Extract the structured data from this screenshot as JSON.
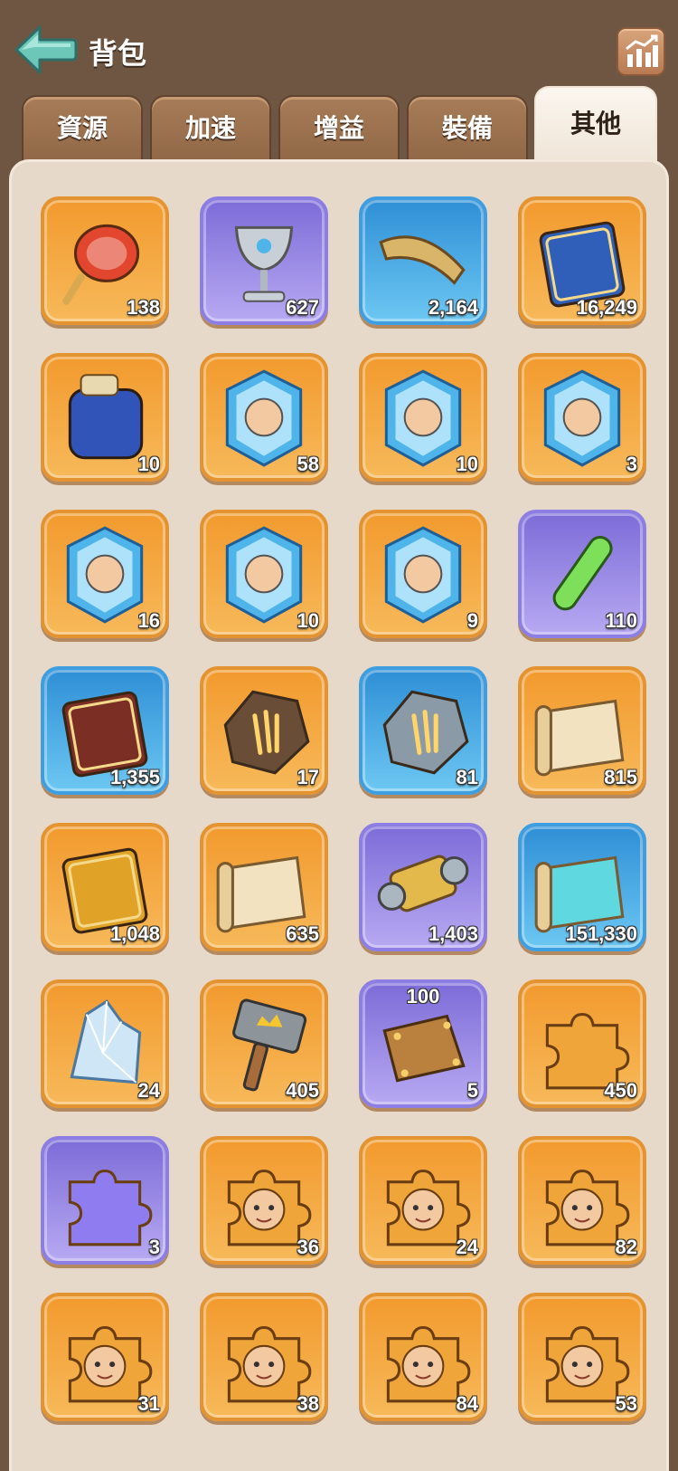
{
  "header": {
    "title": "背包"
  },
  "tabs": [
    {
      "label": "資源",
      "active": false
    },
    {
      "label": "加速",
      "active": false
    },
    {
      "label": "增益",
      "active": false
    },
    {
      "label": "裝備",
      "active": false
    },
    {
      "label": "其他",
      "active": true
    }
  ],
  "items": [
    {
      "name": "potion-flask-icon",
      "color": "orange",
      "count": "138"
    },
    {
      "name": "silver-goblet-icon",
      "color": "purple",
      "count": "627"
    },
    {
      "name": "war-horn-icon",
      "color": "blue",
      "count": "2,164"
    },
    {
      "name": "academy-book-icon",
      "color": "orange",
      "count": "16,249"
    },
    {
      "name": "blue-backpack-icon",
      "color": "orange",
      "count": "10"
    },
    {
      "name": "academy-crystal-icon",
      "color": "orange",
      "count": "58"
    },
    {
      "name": "hero-crystal-warrior-icon",
      "color": "orange",
      "count": "10"
    },
    {
      "name": "hero-crystal-monocle-icon",
      "color": "orange",
      "count": "3"
    },
    {
      "name": "hero-crystal-silver-hair-icon",
      "color": "orange",
      "count": "16"
    },
    {
      "name": "hero-crystal-crowned-icon",
      "color": "orange",
      "count": "10"
    },
    {
      "name": "hero-crystal-knight-icon",
      "color": "orange",
      "count": "9"
    },
    {
      "name": "green-vial-icon",
      "color": "purple",
      "count": "110"
    },
    {
      "name": "paw-book-icon",
      "color": "blue",
      "count": "1,355"
    },
    {
      "name": "gold-claw-stone-icon",
      "color": "orange",
      "count": "17"
    },
    {
      "name": "silver-claw-stone-icon",
      "color": "blue",
      "count": "81"
    },
    {
      "name": "gem-scroll-icon",
      "color": "orange",
      "count": "815"
    },
    {
      "name": "gem-book-icon",
      "color": "orange",
      "count": "1,048"
    },
    {
      "name": "map-scroll-icon",
      "color": "orange",
      "count": "635"
    },
    {
      "name": "gold-thread-spool-icon",
      "color": "purple",
      "count": "1,403"
    },
    {
      "name": "blue-cloth-icon",
      "color": "blue",
      "count": "151,330"
    },
    {
      "name": "ice-crystal-icon",
      "color": "orange",
      "count": "24"
    },
    {
      "name": "crown-hammer-icon",
      "color": "orange",
      "count": "405"
    },
    {
      "name": "bronze-plate-icon",
      "color": "purple",
      "count": "5",
      "top_label": "100"
    },
    {
      "name": "orange-puzzle-piece-icon",
      "color": "orange",
      "count": "450"
    },
    {
      "name": "purple-puzzle-piece-icon",
      "color": "purple",
      "count": "3"
    },
    {
      "name": "pirate-hero-puzzle-icon",
      "color": "orange",
      "count": "36"
    },
    {
      "name": "red-hair-hero-puzzle-icon",
      "color": "orange",
      "count": "24"
    },
    {
      "name": "dark-hair-hero-puzzle-icon",
      "color": "orange",
      "count": "82"
    },
    {
      "name": "spartan-hero-puzzle-icon",
      "color": "orange",
      "count": "31"
    },
    {
      "name": "old-warrior-hero-puzzle-icon",
      "color": "orange",
      "count": "38"
    },
    {
      "name": "swordsman-hero-puzzle-icon",
      "color": "orange",
      "count": "84"
    },
    {
      "name": "nun-hero-puzzle-icon",
      "color": "orange",
      "count": "53"
    }
  ]
}
